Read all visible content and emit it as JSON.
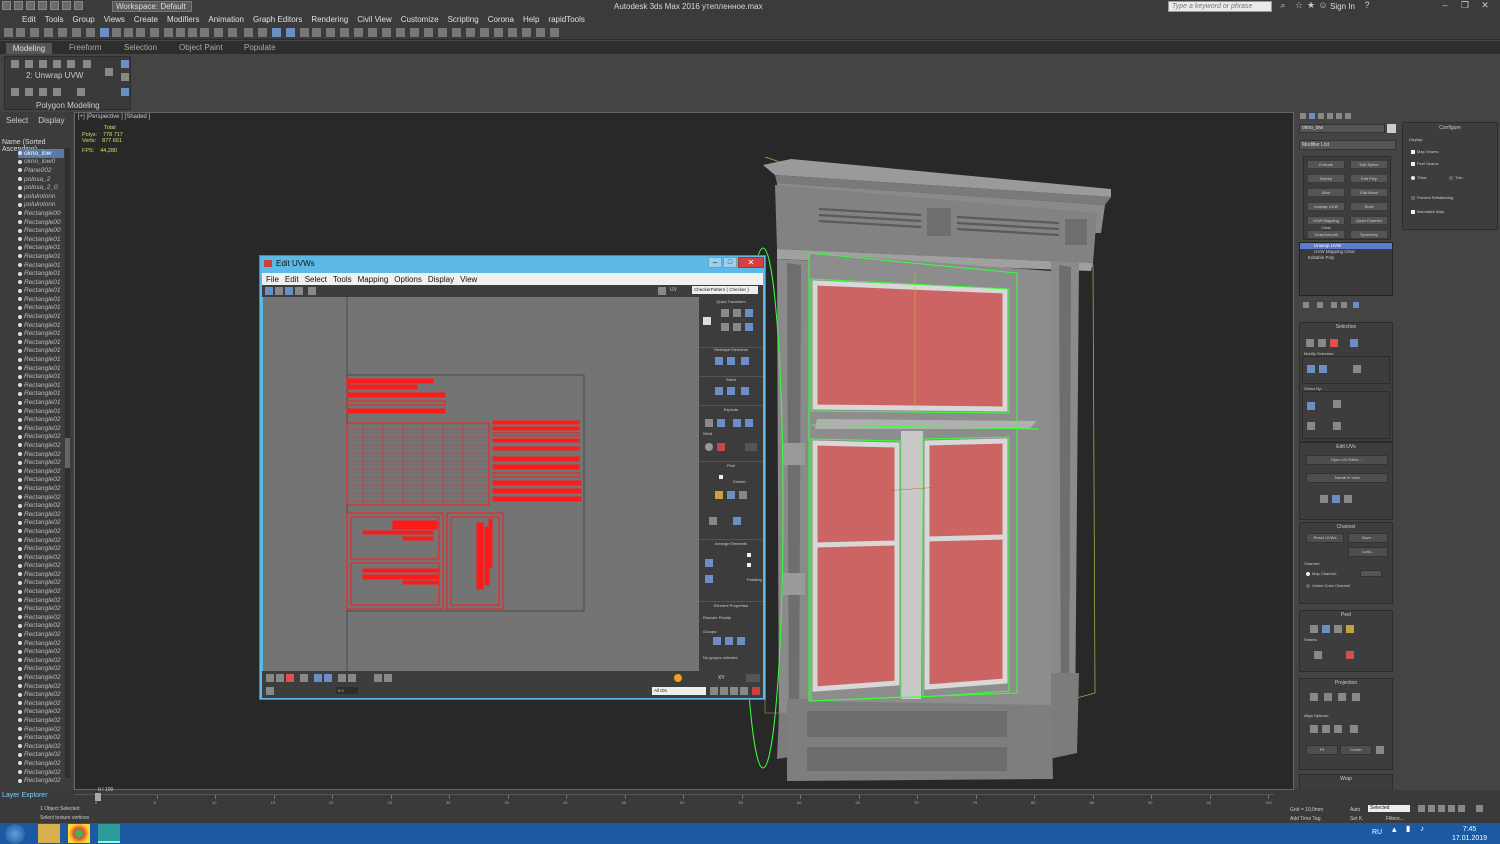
{
  "app": {
    "title": "Autodesk 3ds Max 2016    утепленное.max",
    "workspace": "Workspace: Default",
    "search_placeholder": "Type a keyword or phrase",
    "sign_in": "Sign In"
  },
  "menu": [
    "Edit",
    "Tools",
    "Group",
    "Views",
    "Create",
    "Modifiers",
    "Animation",
    "Graph Editors",
    "Rendering",
    "Civil View",
    "Customize",
    "Scripting",
    "Corona",
    "Help",
    "rapidTools"
  ],
  "ribbon": {
    "tabs": [
      "Modeling",
      "Freeform",
      "Selection",
      "Object Paint",
      "Populate"
    ],
    "active_modifier": "2: Unwrap UVW",
    "panel": "Polygon Modeling"
  },
  "scene_explorer": {
    "tabs": [
      "Select",
      "Display"
    ],
    "header": "Name (Sorted Ascending)",
    "items": [
      "okno_low",
      "okno_low0",
      "Plane002",
      "polosa_2",
      "polosa_2_0",
      "polukolonn",
      "polukolonn",
      "Rectangle00",
      "Rectangle00",
      "Rectangle00",
      "Rectangle01",
      "Rectangle01",
      "Rectangle01",
      "Rectangle01",
      "Rectangle01",
      "Rectangle01",
      "Rectangle01",
      "Rectangle01",
      "Rectangle01",
      "Rectangle01",
      "Rectangle01",
      "Rectangle01",
      "Rectangle01",
      "Rectangle01",
      "Rectangle01",
      "Rectangle01",
      "Rectangle01",
      "Rectangle01",
      "Rectangle01",
      "Rectangle01",
      "Rectangle01",
      "Rectangle02",
      "Rectangle02",
      "Rectangle02",
      "Rectangle02",
      "Rectangle02",
      "Rectangle02",
      "Rectangle02",
      "Rectangle02",
      "Rectangle02",
      "Rectangle02",
      "Rectangle02",
      "Rectangle02",
      "Rectangle02",
      "Rectangle02",
      "Rectangle02",
      "Rectangle02",
      "Rectangle02",
      "Rectangle02",
      "Rectangle02",
      "Rectangle02",
      "Rectangle02",
      "Rectangle02",
      "Rectangle02",
      "Rectangle02",
      "Rectangle02",
      "Rectangle02",
      "Rectangle02",
      "Rectangle02",
      "Rectangle02",
      "Rectangle02",
      "Rectangle02",
      "Rectangle02",
      "Rectangle02",
      "Rectangle02",
      "Rectangle02",
      "Rectangle02",
      "Rectangle02",
      "Rectangle02",
      "Rectangle02",
      "Rectangle02",
      "Rectangle02",
      "Rectangle02",
      "Rectangle02"
    ]
  },
  "viewport": {
    "label": "[+] [Perspective ] [Shaded ]",
    "stats": {
      "total_label": "Total",
      "polys_label": "Polys:",
      "polys": "778 717",
      "verts_label": "Verts:",
      "verts": "877 661",
      "fps_label": "FPS:",
      "fps": "44,280"
    }
  },
  "uvw": {
    "title": "Edit UVWs",
    "menu": [
      "File",
      "Edit",
      "Select",
      "Tools",
      "Mapping",
      "Options",
      "Display",
      "View"
    ],
    "uv_label": "UV",
    "checker": "CheckerPattern ( Checker )",
    "sections": [
      "Quick Transform",
      "Reshape Elements",
      "Stitch",
      "Explode",
      "Weld",
      "Peel",
      "Detach",
      "Arrange Elements",
      "Padding",
      "Element Properties",
      "Rescale Priority",
      "Groups:",
      "No groups selected"
    ],
    "ids": "All IDs",
    "xy": "XY",
    "zoom": "0.0"
  },
  "command_panel": {
    "object_name": "okno_low",
    "modifier_list": "Modifier List",
    "buttons": [
      "Extrude",
      "Edit Spline",
      "Sweep",
      "Edit Poly",
      "Slice",
      "Edit Mesh",
      "Unwrap UVW",
      "Shell",
      "UVW Mapping Clear",
      "Quad Chamfer",
      "TurboSmooth",
      "Symmetry"
    ],
    "stack": [
      "Unwrap UVW",
      "UVW Mapping Clear",
      "Editable Poly"
    ],
    "rollouts": {
      "selection": "Selection",
      "modify_selection": "Modify Selection:",
      "select_by": "Select By:",
      "edit_uvs": "Edit UVs",
      "open_uv_editor": "Open UV Editor ...",
      "tweak_in_view": "Tweak In View",
      "channel": "Channel",
      "reset_uvws": "Reset UVWs",
      "save": "Save...",
      "load": "Load...",
      "channel_label": "Channel:",
      "map_channel": "Map Channel:",
      "vertex_color_channel": "Vertex Color Channel",
      "peel": "Peel",
      "seams": "Seams:",
      "projection": "Projection",
      "align_options": "Align Options:",
      "fit": "Fit",
      "center": "Center",
      "wrap": "Wrap"
    }
  },
  "configure": {
    "title": "Configure",
    "display": "Display:",
    "map_seams": "Map Seams",
    "peel_seams": "Peel Seams",
    "thick": "Thick",
    "thin": "Thin",
    "prevent_reflattening": "Prevent Reflattening",
    "normalize_map": "Normalize Map"
  },
  "timeline": {
    "frame": "0 / 100",
    "ticks": [
      "0",
      "5",
      "10",
      "15",
      "20",
      "25",
      "30",
      "35",
      "40",
      "45",
      "50",
      "55",
      "60",
      "65",
      "70",
      "75",
      "80",
      "85",
      "90",
      "95",
      "100"
    ],
    "layer_explorer": "Layer Explorer",
    "status_selected": "1 Object Selected",
    "status_hint": "Select texture vertices",
    "grid": "Grid = 10,0mm",
    "add_time_tag": "Add Time Tag",
    "auto": "Auto",
    "set_k": "Set K.",
    "selected": "Selected",
    "filters": "Filters..."
  },
  "taskbar": {
    "lang": "RU",
    "time": "7:45",
    "date": "17.01.2019"
  },
  "colors": {
    "uv_red": "#ff1a1a",
    "glass_pink": "#cd6464",
    "frame_grey": "#8d8d8d",
    "wire_green": "#3bff3b"
  }
}
